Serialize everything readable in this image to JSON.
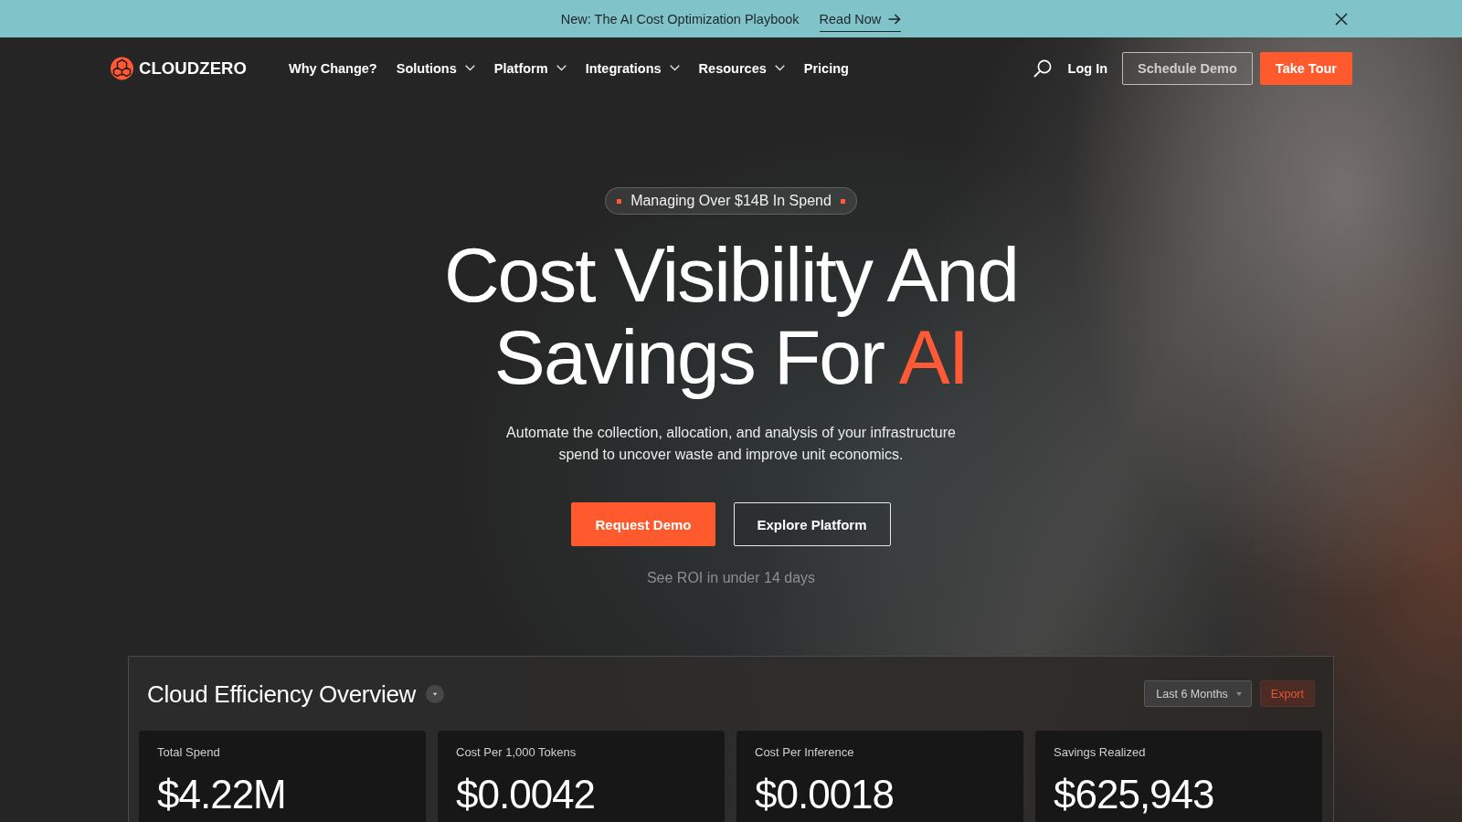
{
  "announcement": {
    "text": "New: The AI Cost Optimization Playbook",
    "link": "Read Now"
  },
  "nav": {
    "brand": "CLOUDZERO",
    "items": [
      {
        "label": "Why Change?",
        "dropdown": false
      },
      {
        "label": "Solutions",
        "dropdown": true
      },
      {
        "label": "Platform",
        "dropdown": true
      },
      {
        "label": "Integrations",
        "dropdown": true
      },
      {
        "label": "Resources",
        "dropdown": true
      },
      {
        "label": "Pricing",
        "dropdown": false
      }
    ],
    "login": "Log In",
    "buttons": [
      {
        "label": "Schedule Demo",
        "kind": "outline"
      },
      {
        "label": "Take Tour",
        "kind": "primary"
      }
    ]
  },
  "hero": {
    "badge": "Managing Over $14B In Spend",
    "headline": {
      "lines": [
        [
          {
            "text": "Cost Visibility And",
            "accent": false
          }
        ],
        [
          {
            "text": "Savings For",
            "accent": false
          },
          {
            "text": "AI",
            "accent": true
          }
        ]
      ]
    },
    "subtitle": "Automate the collection, allocation, and analysis of your infrastructure spend to uncover waste and improve unit economics.",
    "buttons": [
      {
        "label": "Request Demo",
        "kind": "primary"
      },
      {
        "label": "Explore Platform",
        "kind": "outline"
      }
    ],
    "note": "See ROI in under 14 days"
  },
  "dashboard": {
    "title": "Cloud Efficiency Overview",
    "range": "Last 6 Months",
    "export": "Export",
    "metrics": [
      {
        "label": "Total Spend",
        "value": "$4.22M"
      },
      {
        "label": "Cost Per 1,000 Tokens",
        "value": "$0.0042"
      },
      {
        "label": "Cost Per Inference",
        "value": "$0.0018"
      },
      {
        "label": "Savings Realized",
        "value": "$625,943"
      }
    ]
  }
}
